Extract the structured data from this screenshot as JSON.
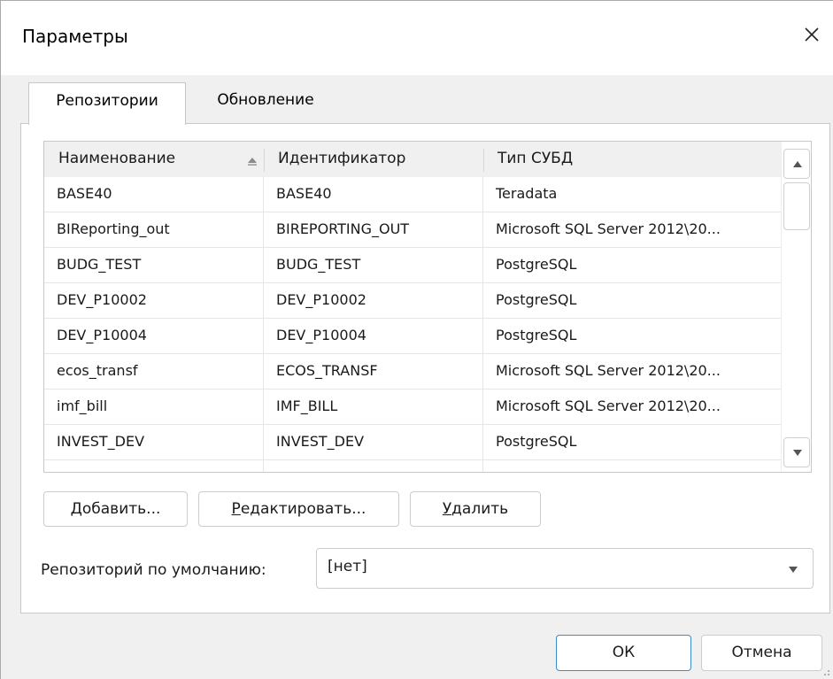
{
  "window": {
    "title": "Параметры",
    "close_icon": "close-icon"
  },
  "tabs": [
    {
      "label": "Репозитории",
      "active": true
    },
    {
      "label": "Обновление",
      "active": false
    }
  ],
  "grid": {
    "columns": [
      "Наименование",
      "Идентификатор",
      "Тип СУБД"
    ],
    "sort_column": "Наименование",
    "sort_direction": "ascending",
    "rows": [
      [
        "BASE40",
        "BASE40",
        "Teradata"
      ],
      [
        "BIReporting_out",
        "BIREPORTING_OUT",
        "Microsoft SQL Server 2012\\20..."
      ],
      [
        "BUDG_TEST",
        "BUDG_TEST",
        "PostgreSQL"
      ],
      [
        "DEV_P10002",
        "DEV_P10002",
        "PostgreSQL"
      ],
      [
        "DEV_P10004",
        "DEV_P10004",
        "PostgreSQL"
      ],
      [
        "ecos_transf",
        "ECOS_TRANSF",
        "Microsoft SQL Server 2012\\20..."
      ],
      [
        "imf_bill",
        "IMF_BILL",
        "Microsoft SQL Server 2012\\20..."
      ],
      [
        "INVEST_DEV",
        "INVEST_DEV",
        "PostgreSQL"
      ],
      [
        "",
        "",
        ""
      ]
    ]
  },
  "actions": {
    "add": {
      "mnemonic": "Д",
      "rest": "обавить..."
    },
    "edit": {
      "mnemonic": "Р",
      "rest": "едактировать..."
    },
    "delete": {
      "mnemonic": "У",
      "rest": "далить"
    }
  },
  "default_repo": {
    "label": "Репозиторий по умолчанию:",
    "value": "[нет]"
  },
  "footer": {
    "ok_label": "ОК",
    "cancel_label": "Отмена"
  },
  "colors": {
    "dialog_bg": "#f0f0f0",
    "panel_bg": "#ffffff",
    "header_bg": "#f0f0f0",
    "border": "#c8c8c8",
    "default_button_border": "#3c8ad6"
  }
}
